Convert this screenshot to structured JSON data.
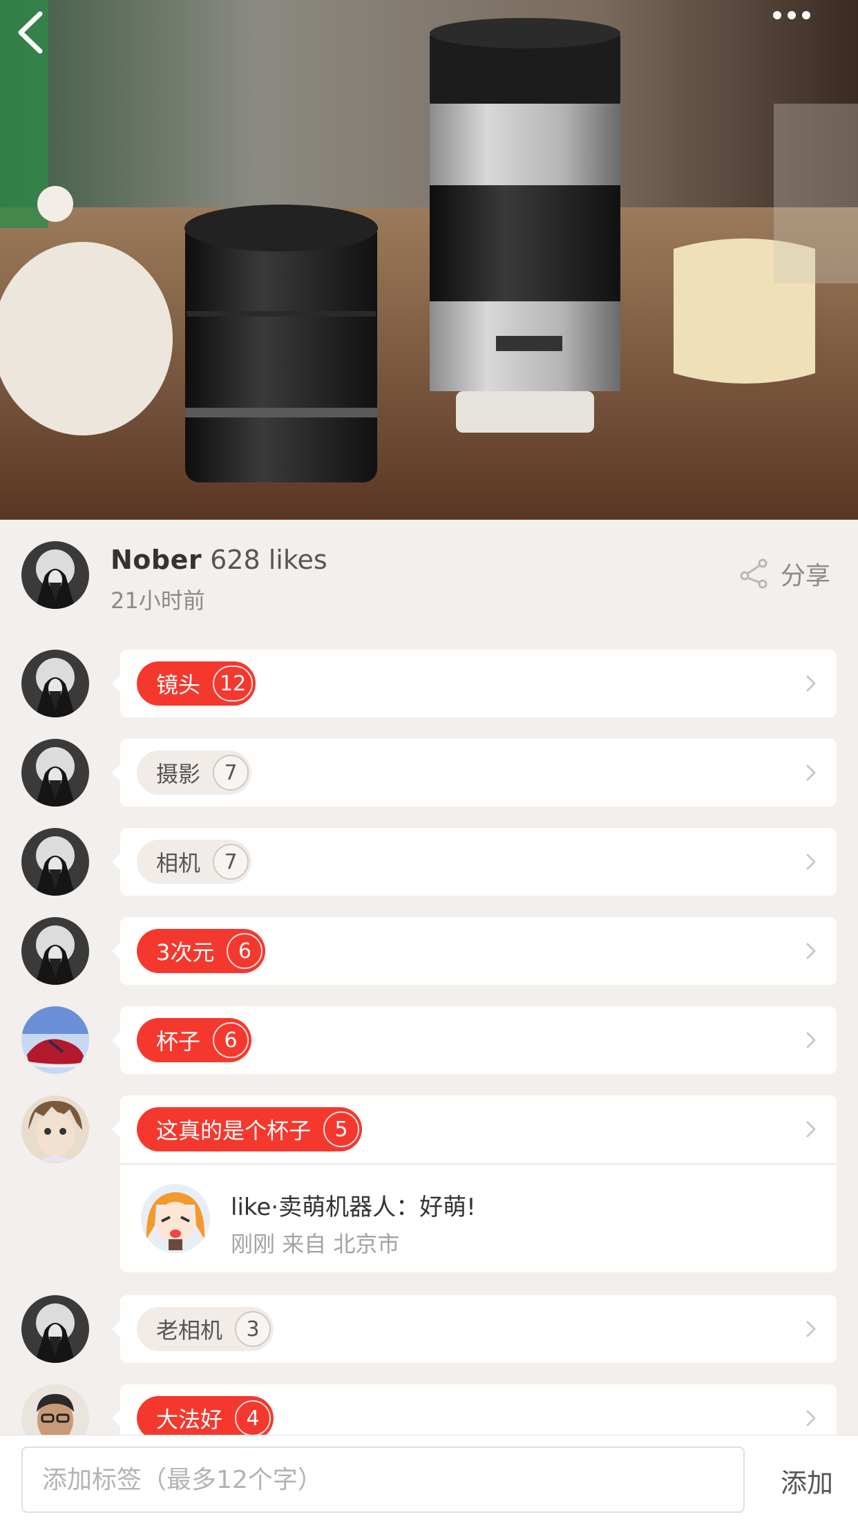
{
  "header": {
    "back_icon": "chevron-left-icon",
    "more_icon": "more-dots-icon"
  },
  "post": {
    "author_name": "Nober",
    "likes": "628 likes",
    "time": "21小时前",
    "share_label": "分享",
    "share_icon": "share-icon"
  },
  "tags": [
    {
      "label": "镜头",
      "count": "12",
      "style": "red"
    },
    {
      "label": "摄影",
      "count": "7",
      "style": "grey"
    },
    {
      "label": "相机",
      "count": "7",
      "style": "grey"
    },
    {
      "label": "3次元",
      "count": "6",
      "style": "red"
    },
    {
      "label": "杯子",
      "count": "6",
      "style": "red"
    },
    {
      "label": "这真的是个杯子",
      "count": "5",
      "style": "red"
    },
    {
      "label": "老相机",
      "count": "3",
      "style": "grey"
    },
    {
      "label": "大法好",
      "count": "4",
      "style": "red"
    }
  ],
  "comment": {
    "text": "like·卖萌机器人：好萌!",
    "meta": "刚刚 来自 北京市"
  },
  "input": {
    "placeholder": "添加标签（最多12个字）",
    "add_label": "添加"
  },
  "colors": {
    "accent": "#f5382e",
    "page_bg": "#f3efec"
  }
}
